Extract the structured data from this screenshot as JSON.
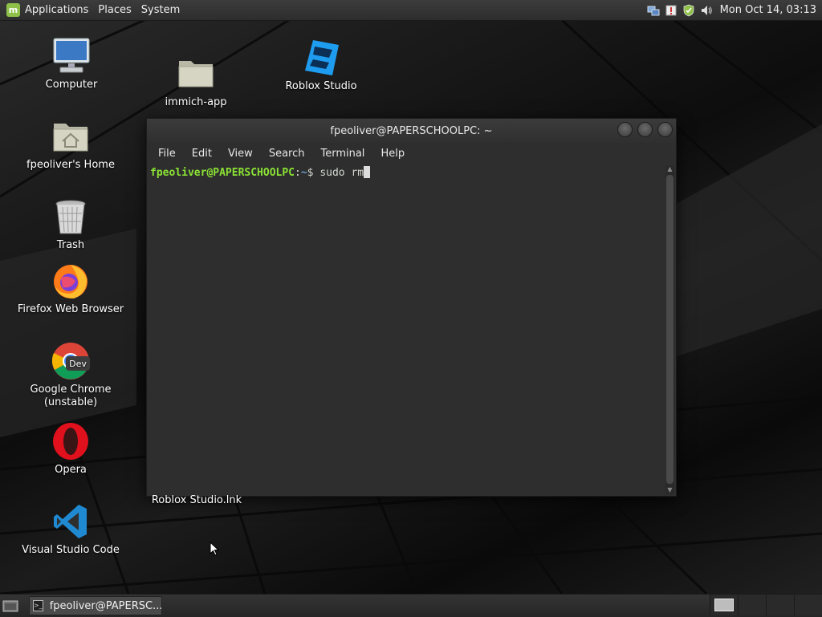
{
  "top_panel": {
    "menus": [
      "Applications",
      "Places",
      "System"
    ],
    "clock": "Mon Oct 14, 03:13",
    "tray_icons": [
      "network-icon",
      "update-manager-icon",
      "shield-icon",
      "volume-icon"
    ]
  },
  "desktop_icons": [
    {
      "label": "Computer",
      "icon": "computer-icon"
    },
    {
      "label": "immich-app",
      "icon": "folder-icon"
    },
    {
      "label": "Roblox Studio",
      "icon": "roblox-studio-icon"
    },
    {
      "label": "fpeoliver's Home",
      "icon": "home-folder-icon"
    },
    {
      "label": "Trash",
      "icon": "trash-icon"
    },
    {
      "label": "Firefox Web Browser",
      "icon": "firefox-icon"
    },
    {
      "label": "Google Chrome (unstable)",
      "icon": "chrome-dev-icon",
      "badge": "Dev"
    },
    {
      "label": "Opera",
      "icon": "opera-icon"
    },
    {
      "label": "Visual Studio Code",
      "icon": "vscode-icon"
    },
    {
      "label": "Roblox Studio.lnk",
      "icon": "shortcut-file"
    }
  ],
  "terminal": {
    "title": "fpeoliver@PAPERSCHOOLPC: ~",
    "menu": [
      "File",
      "Edit",
      "View",
      "Search",
      "Terminal",
      "Help"
    ],
    "prompt_user": "fpeoliver@PAPERSCHOOLPC",
    "prompt_sep": ":",
    "prompt_path": "~",
    "prompt_dollar": "$",
    "command": " sudo rm"
  },
  "bottom_panel": {
    "task_label": "fpeoliver@PAPERSC..."
  },
  "colors": {
    "mint_green": "#8fc14a",
    "prompt_green": "#8ae234",
    "prompt_blue": "#729fcf"
  }
}
